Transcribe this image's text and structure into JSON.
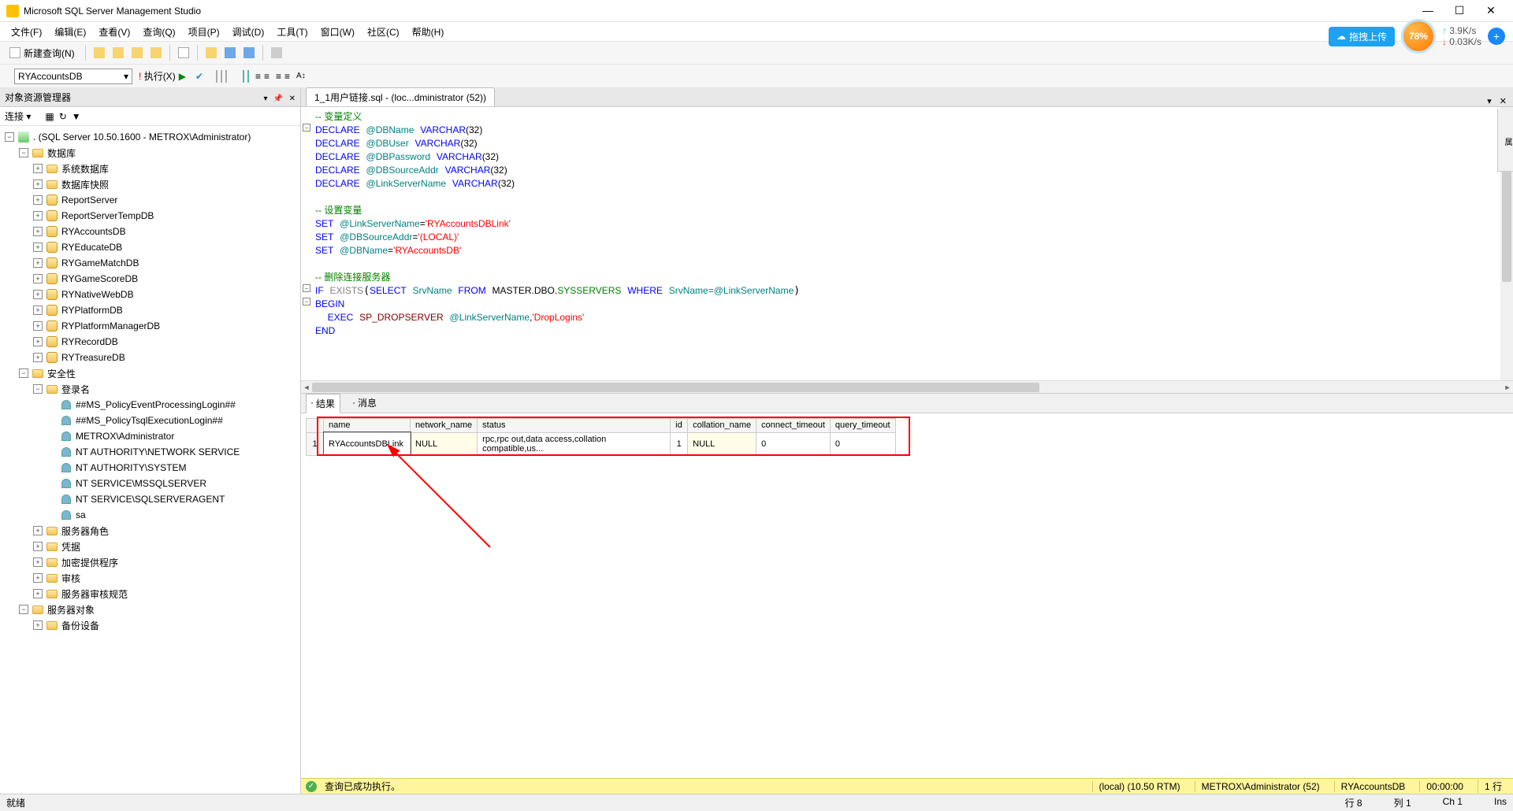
{
  "titlebar": {
    "title": "Microsoft SQL Server Management Studio"
  },
  "menubar": [
    "文件(F)",
    "编辑(E)",
    "查看(V)",
    "查询(Q)",
    "项目(P)",
    "调试(D)",
    "工具(T)",
    "窗口(W)",
    "社区(C)",
    "帮助(H)"
  ],
  "widgets": {
    "cloud_label": "拖拽上传",
    "percent": "78%",
    "speed_up": "3.9K/s",
    "speed_down": "0.03K/s",
    "blue_badge": "+"
  },
  "toolbar1": {
    "new_query": "新建查询(N)"
  },
  "toolbar2": {
    "db_combo_value": "RYAccountsDB",
    "execute_label": "执行(X)"
  },
  "objExplorer": {
    "title": "对象资源管理器",
    "connect_label": "连接 ▾",
    "server_node": ". (SQL Server 10.50.1600 - METROX\\Administrator)",
    "databases_label": "数据库",
    "sys_db_label": "系统数据库",
    "db_snapshot_label": "数据库快照",
    "dbs": [
      "ReportServer",
      "ReportServerTempDB",
      "RYAccountsDB",
      "RYEducateDB",
      "RYGameMatchDB",
      "RYGameScoreDB",
      "RYNativeWebDB",
      "RYPlatformDB",
      "RYPlatformManagerDB",
      "RYRecordDB",
      "RYTreasureDB"
    ],
    "security_label": "安全性",
    "logins_label": "登录名",
    "logins": [
      "##MS_PolicyEventProcessingLogin##",
      "##MS_PolicyTsqlExecutionLogin##",
      "METROX\\Administrator",
      "NT AUTHORITY\\NETWORK SERVICE",
      "NT AUTHORITY\\SYSTEM",
      "NT SERVICE\\MSSQLSERVER",
      "NT SERVICE\\SQLSERVERAGENT",
      "sa"
    ],
    "server_roles_label": "服务器角色",
    "credentials_label": "凭据",
    "crypto_providers_label": "加密提供程序",
    "audits_label": "审核",
    "server_audit_specs_label": "服务器审核规范",
    "server_objects_label": "服务器对象",
    "backup_devices_label": "备份设备"
  },
  "doc_tab": {
    "title": "1_1用户链接.sql - (loc...dministrator (52))"
  },
  "sql": {
    "c1": "-- 变量定义",
    "d1a": "DECLARE",
    "d1b": "@DBName",
    "d1c": "VARCHAR",
    "d1d": "(32)",
    "d2b": "@DBUser",
    "d3b": "@DBPassword",
    "d4b": "@DBSourceAddr",
    "d5b": "@LinkServerName",
    "c2": "-- 设置变量",
    "s1a": "SET",
    "s1b": "@LinkServerName",
    "s1c": "=",
    "s1d": "'RYAccountsDBLink'",
    "s2b": "@DBSourceAddr",
    "s2d": "'(LOCAL)'",
    "s3b": "@DBName",
    "s3d": "'RYAccountsDB'",
    "c3": "-- 删除连接服务器",
    "if": "IF",
    "exists": "EXISTS",
    "select": "SELECT",
    "srvname": "SrvName",
    "from": "FROM",
    "master": "MASTER.DBO.",
    "sysservers": "SYSSERVERS",
    "where": "WHERE",
    "srveq": "SrvName=@LinkServerName",
    "begin": "BEGIN",
    "exec": "EXEC",
    "dropserver": "SP_DROPSERVER",
    "linkvar": "@LinkServerName",
    "comma": ",",
    "droplogins": "'DropLogins'",
    "end": "END"
  },
  "results": {
    "tab_results": "结果",
    "tab_messages": "消息",
    "headers": [
      "name",
      "network_name",
      "status",
      "id",
      "collation_name",
      "connect_timeout",
      "query_timeout"
    ],
    "row_num": "1",
    "cells": [
      "RYAccountsDBLink",
      "NULL",
      "rpc,rpc out,data access,collation compatible,us...",
      "1",
      "NULL",
      "0",
      "0"
    ]
  },
  "exec_status": {
    "msg": "查询已成功执行。",
    "server": "(local) (10.50 RTM)",
    "user": "METROX\\Administrator (52)",
    "db": "RYAccountsDB",
    "time": "00:00:00",
    "rows": "1 行"
  },
  "statusbar": {
    "ready": "就绪",
    "line": "行 8",
    "col": "列 1",
    "ch": "Ch 1",
    "ins": "Ins"
  }
}
